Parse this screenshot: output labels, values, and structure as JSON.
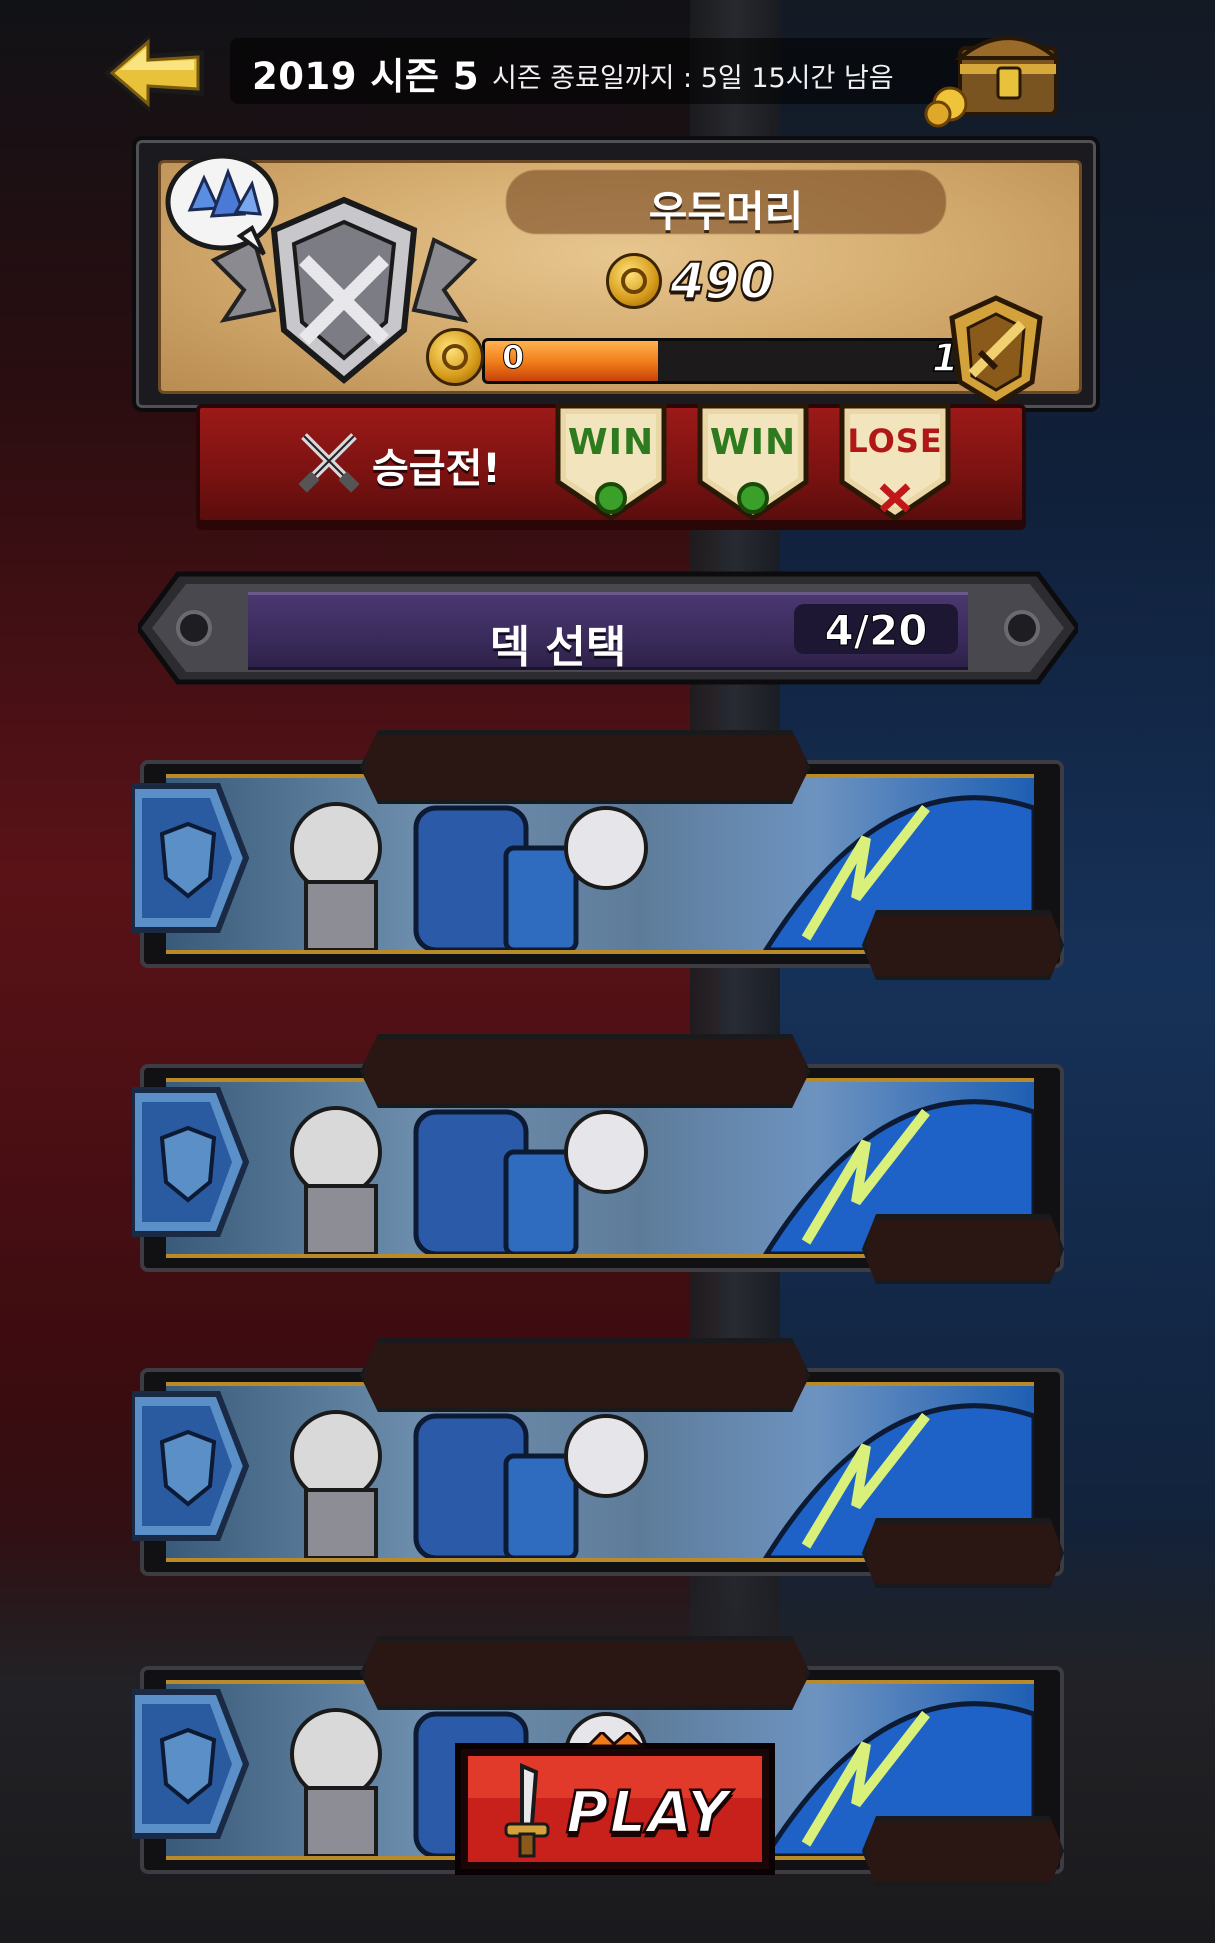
{
  "header": {
    "season_title": "2019 시즌 5",
    "season_remaining": "시즌 종료일까지 : 5일 15시간 남음",
    "back_icon": "arrow-left-icon",
    "chest_icon": "treasure-chest-icon"
  },
  "rank": {
    "player_name": "우두머리",
    "points": "490",
    "progress_min": "0",
    "progress_max": "150",
    "progress_fraction": 0.32,
    "tier_icon": "silver-shield-emblem-icon",
    "next_tier_icon": "gold-sword-emblem-icon",
    "bubble_icon": "crystal-bubble-icon"
  },
  "promotion": {
    "label": "승급전!",
    "icon": "crossed-swords-icon",
    "results": [
      {
        "text": "WIN",
        "status": "win"
      },
      {
        "text": "WIN",
        "status": "win"
      },
      {
        "text": "LOSE",
        "status": "lose"
      }
    ]
  },
  "deck_select": {
    "title": "덱 선택",
    "count": "4/20"
  },
  "decks": [
    {
      "name": "",
      "count": ""
    },
    {
      "name": "",
      "count": ""
    },
    {
      "name": "",
      "count": ""
    },
    {
      "name": "",
      "count": ""
    }
  ],
  "play_button": {
    "label": "PLAY",
    "icon": "sword-icon"
  },
  "colors": {
    "accent_orange": "#f07a18",
    "win_green": "#2e7a1e",
    "lose_red": "#c01818",
    "deck_purple": "#3a2b5c",
    "play_red": "#c8201a"
  }
}
